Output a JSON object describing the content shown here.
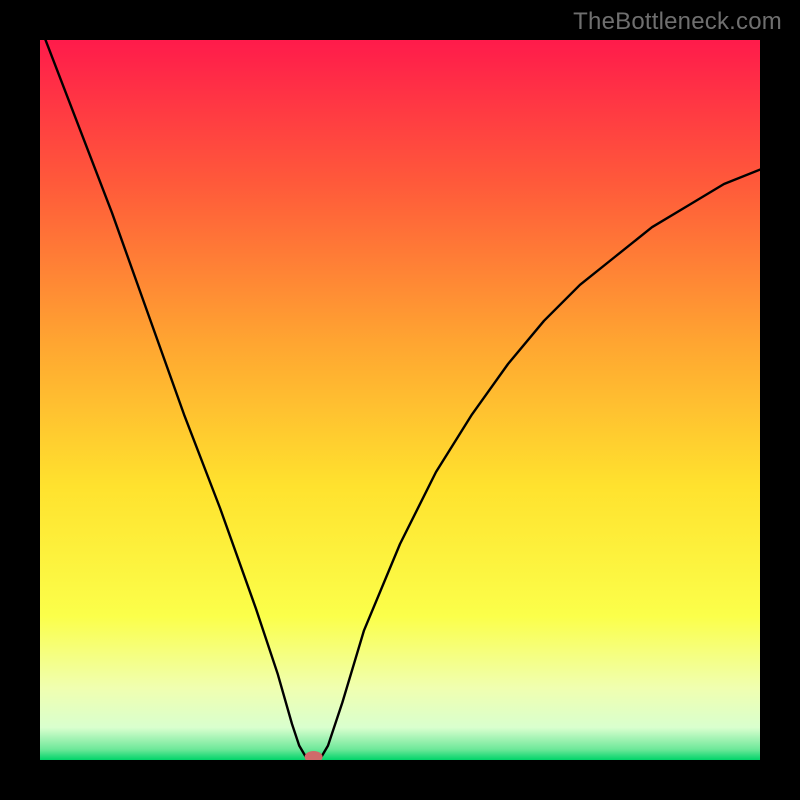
{
  "watermark": "TheBottleneck.com",
  "chart_data": {
    "type": "line",
    "title": "",
    "xlabel": "",
    "ylabel": "",
    "xlim": [
      0,
      100
    ],
    "ylim": [
      0,
      100
    ],
    "x_minimum": 38,
    "marker": {
      "x": 38,
      "y": 0,
      "color": "#d06a6a"
    },
    "curve_points": [
      {
        "x": 0,
        "y": 102
      },
      {
        "x": 5,
        "y": 89
      },
      {
        "x": 10,
        "y": 76
      },
      {
        "x": 15,
        "y": 62
      },
      {
        "x": 20,
        "y": 48
      },
      {
        "x": 25,
        "y": 35
      },
      {
        "x": 30,
        "y": 21
      },
      {
        "x": 33,
        "y": 12
      },
      {
        "x": 35,
        "y": 5
      },
      {
        "x": 36,
        "y": 2
      },
      {
        "x": 37,
        "y": 0.3
      },
      {
        "x": 38,
        "y": 0
      },
      {
        "x": 39,
        "y": 0.3
      },
      {
        "x": 40,
        "y": 2
      },
      {
        "x": 42,
        "y": 8
      },
      {
        "x": 45,
        "y": 18
      },
      {
        "x": 50,
        "y": 30
      },
      {
        "x": 55,
        "y": 40
      },
      {
        "x": 60,
        "y": 48
      },
      {
        "x": 65,
        "y": 55
      },
      {
        "x": 70,
        "y": 61
      },
      {
        "x": 75,
        "y": 66
      },
      {
        "x": 80,
        "y": 70
      },
      {
        "x": 85,
        "y": 74
      },
      {
        "x": 90,
        "y": 77
      },
      {
        "x": 95,
        "y": 80
      },
      {
        "x": 100,
        "y": 82
      }
    ],
    "gradient_stops": [
      {
        "offset": 0.0,
        "color": "#ff1b4b"
      },
      {
        "offset": 0.2,
        "color": "#ff5a3a"
      },
      {
        "offset": 0.42,
        "color": "#ffa531"
      },
      {
        "offset": 0.62,
        "color": "#ffe22e"
      },
      {
        "offset": 0.8,
        "color": "#fbff4a"
      },
      {
        "offset": 0.9,
        "color": "#f0ffb0"
      },
      {
        "offset": 0.955,
        "color": "#d9ffce"
      },
      {
        "offset": 0.985,
        "color": "#6fe89a"
      },
      {
        "offset": 1.0,
        "color": "#00d46a"
      }
    ]
  }
}
